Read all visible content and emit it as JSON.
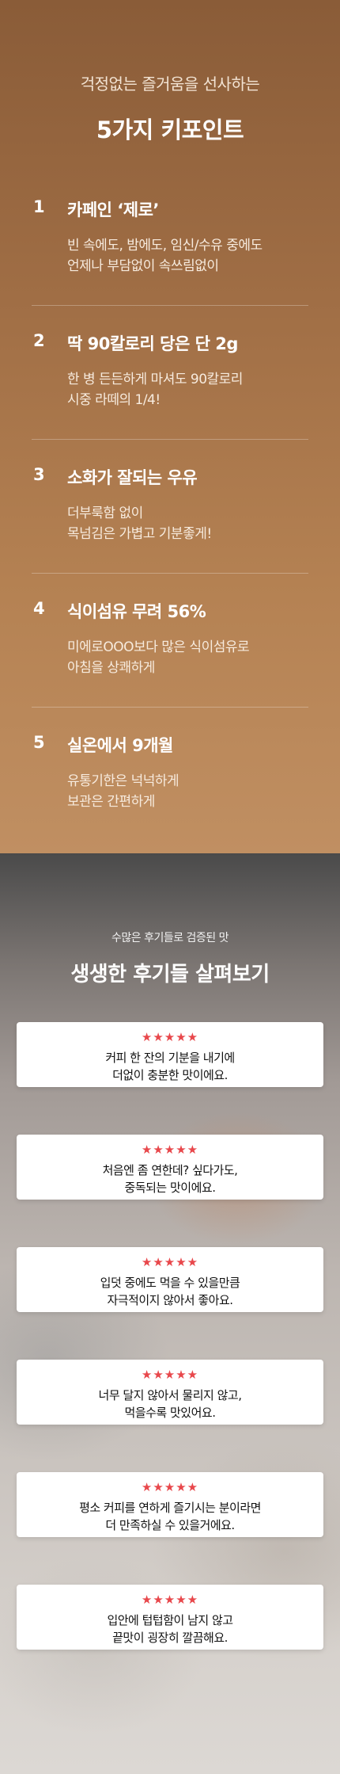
{
  "points_section": {
    "subtitle": "걱정없는 즐거움을 선사하는",
    "title": "5가지 키포인트",
    "items": [
      {
        "number": "1",
        "title": "카페인 ‘제로’",
        "desc": [
          "빈 속에도, 밤에도, 임신/수유 중에도",
          "언제나 부담없이 속쓰림없이"
        ]
      },
      {
        "number": "2",
        "title": "딱 90칼로리 당은 단 2g",
        "desc": [
          "한 병 든든하게 마셔도 90칼로리",
          "시중 라떼의 1/4!"
        ]
      },
      {
        "number": "3",
        "title": "소화가 잘되는 우유",
        "desc": [
          "더부룩함 없이",
          "목넘김은 가볍고 기분좋게!"
        ]
      },
      {
        "number": "4",
        "title": "식이섬유 무려 56%",
        "desc": [
          "미에로OOO보다 많은 식이섬유로",
          "아침을 상쾌하게"
        ]
      },
      {
        "number": "5",
        "title": "실온에서 9개월",
        "desc": [
          "유통기한은 넉넉하게",
          "보관은 간편하게"
        ]
      }
    ]
  },
  "reviews_section": {
    "subtitle": "수많은 후기들로 검증된 맛",
    "title": "생생한 후기들 살펴보기",
    "star_color": "#e8474b",
    "items": [
      {
        "rating": 5,
        "stars": "★★★★★",
        "lines": [
          "커피 한 잔의 기분을 내기에",
          "더없이 충분한 맛이에요."
        ]
      },
      {
        "rating": 5,
        "stars": "★★★★★",
        "lines": [
          "처음엔 좀 연한데? 싶다가도,",
          "중독되는 맛이에요."
        ]
      },
      {
        "rating": 5,
        "stars": "★★★★★",
        "lines": [
          "입덧 중에도 먹을 수 있을만큼",
          "자극적이지 않아서 좋아요."
        ]
      },
      {
        "rating": 5,
        "stars": "★★★★★",
        "lines": [
          "너무 달지 않아서 물리지 않고,",
          "먹을수록 맛있어요."
        ]
      },
      {
        "rating": 5,
        "stars": "★★★★★",
        "lines": [
          "평소 커피를 연하게 즐기시는 분이라면",
          "더 만족하실 수 있을거에요."
        ]
      },
      {
        "rating": 5,
        "stars": "★★★★★",
        "lines": [
          "입안에 텁텁함이 남지 않고",
          "끝맛이 굉장히 깔끔해요."
        ]
      }
    ]
  }
}
